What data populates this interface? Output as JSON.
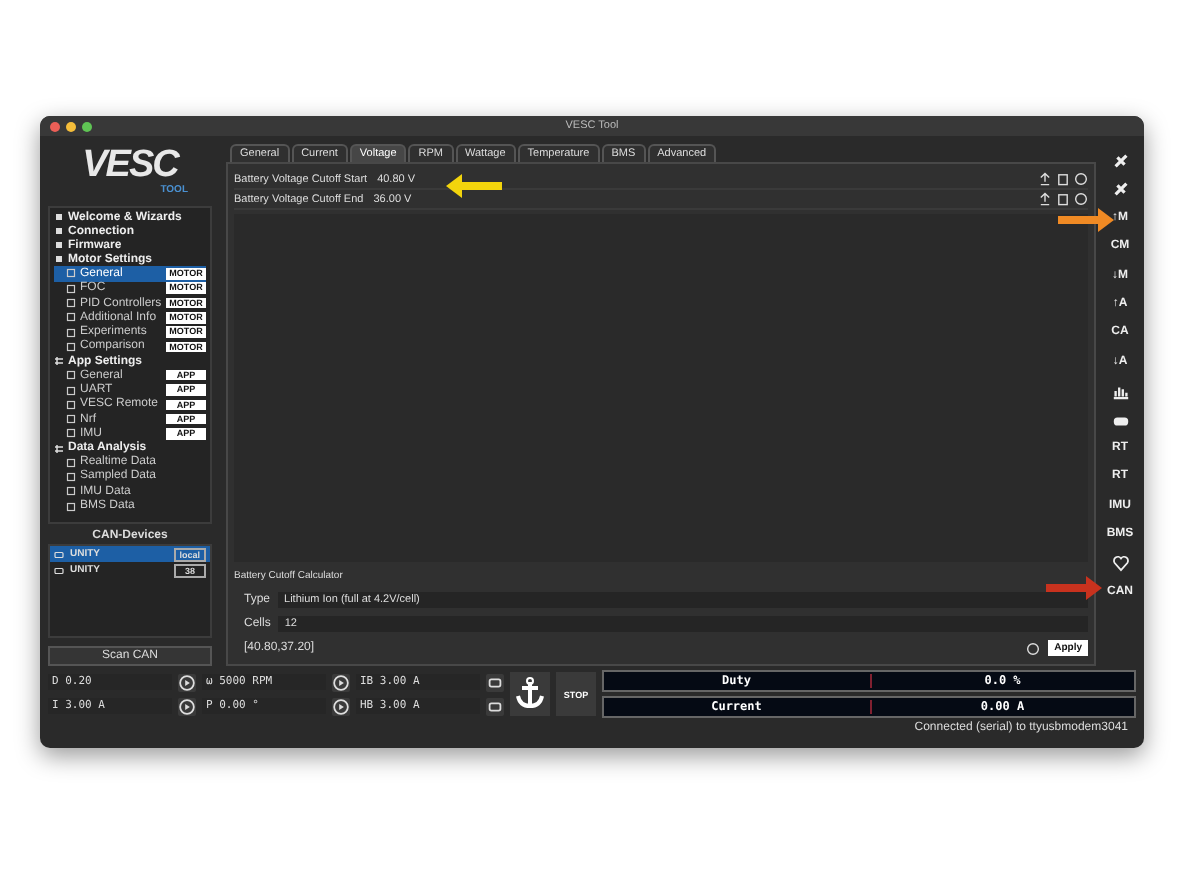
{
  "window": {
    "title": "VESC Tool"
  },
  "logo": {
    "brand": "VESC",
    "sub": "TOOL"
  },
  "sidebar": {
    "groups": [
      {
        "label": "Welcome & Wizards"
      },
      {
        "label": "Connection"
      },
      {
        "label": "Firmware"
      },
      {
        "label": "Motor Settings",
        "children": [
          {
            "label": "General",
            "badge": "MOTOR",
            "selected": true
          },
          {
            "label": "FOC",
            "badge": "MOTOR",
            "selected": false
          },
          {
            "label": "PID Controllers",
            "badge": "MOTOR",
            "selected": false
          },
          {
            "label": "Additional Info",
            "badge": "MOTOR",
            "selected": false
          },
          {
            "label": "Experiments",
            "badge": "MOTOR",
            "selected": false
          },
          {
            "label": "Comparison",
            "badge": "MOTOR",
            "selected": false
          }
        ]
      },
      {
        "label": "App Settings",
        "children": [
          {
            "label": "General",
            "badge": "APP",
            "selected": false
          },
          {
            "label": "UART",
            "badge": "APP",
            "selected": false
          },
          {
            "label": "VESC Remote",
            "badge": "APP",
            "selected": false
          },
          {
            "label": "Nrf",
            "badge": "APP",
            "selected": false
          },
          {
            "label": "IMU",
            "badge": "APP",
            "selected": false
          }
        ]
      },
      {
        "label": "Data Analysis",
        "children": [
          {
            "label": "Realtime Data",
            "selected": false
          },
          {
            "label": "Sampled Data",
            "selected": false
          },
          {
            "label": "IMU Data",
            "selected": false
          },
          {
            "label": "BMS Data",
            "selected": false
          }
        ]
      }
    ]
  },
  "can_devices": {
    "title": "CAN-Devices",
    "devices": [
      {
        "name": "UNITY",
        "badge": "local",
        "selected": true
      },
      {
        "name": "UNITY",
        "badge": "38",
        "selected": false
      }
    ],
    "scan_button": "Scan CAN"
  },
  "tabs": [
    {
      "label": "General",
      "selected": false
    },
    {
      "label": "Current",
      "selected": false
    },
    {
      "label": "Voltage",
      "selected": true
    },
    {
      "label": "RPM",
      "selected": false
    },
    {
      "label": "Wattage",
      "selected": false
    },
    {
      "label": "Temperature",
      "selected": false
    },
    {
      "label": "BMS",
      "selected": false
    },
    {
      "label": "Advanced",
      "selected": false
    }
  ],
  "params": [
    {
      "label": "Battery Voltage Cutoff Start",
      "value": "40.80 V"
    },
    {
      "label": "Battery Voltage Cutoff End",
      "value": "36.00 V"
    }
  ],
  "calculator": {
    "title": "Battery Cutoff Calculator",
    "type_label": "Type",
    "type_value": "Lithium Ion (full at 4.2V/cell)",
    "cells_label": "Cells",
    "cells_value": "12",
    "result": "[40.80,37.20]",
    "apply": "Apply"
  },
  "toolbar": [
    {
      "kind": "icon"
    },
    {
      "kind": "icon"
    },
    {
      "kind": "text",
      "label": "↑M"
    },
    {
      "kind": "text",
      "label": "CM"
    },
    {
      "kind": "text",
      "label": "↓M"
    },
    {
      "kind": "text",
      "label": "↑A"
    },
    {
      "kind": "text",
      "label": "CA"
    },
    {
      "kind": "text",
      "label": "↓A"
    },
    {
      "kind": "icon"
    },
    {
      "kind": "icon"
    },
    {
      "kind": "text",
      "label": "RT"
    },
    {
      "kind": "text",
      "label": "RT"
    },
    {
      "kind": "text",
      "label": "IMU"
    },
    {
      "kind": "text",
      "label": "BMS"
    },
    {
      "kind": "icon"
    },
    {
      "kind": "text",
      "label": "CAN"
    }
  ],
  "controls": [
    [
      {
        "value": "D 0.20"
      },
      {
        "value": "ω 5000 RPM"
      },
      {
        "value": "IB 3.00 A"
      }
    ],
    [
      {
        "value": "I 3.00 A"
      },
      {
        "value": "P 0.00 °"
      },
      {
        "value": "HB 3.00 A"
      }
    ]
  ],
  "stop_button": "STOP",
  "meters": [
    {
      "label": "Duty",
      "reading": "0.0 %"
    },
    {
      "label": "Current",
      "reading": "0.00 A"
    }
  ],
  "status_bar": "Connected (serial) to ttyusbmodem3041",
  "annotations": [
    {
      "color": "#f2d40c"
    },
    {
      "color": "#f08a24"
    },
    {
      "color": "#c8321e"
    }
  ]
}
